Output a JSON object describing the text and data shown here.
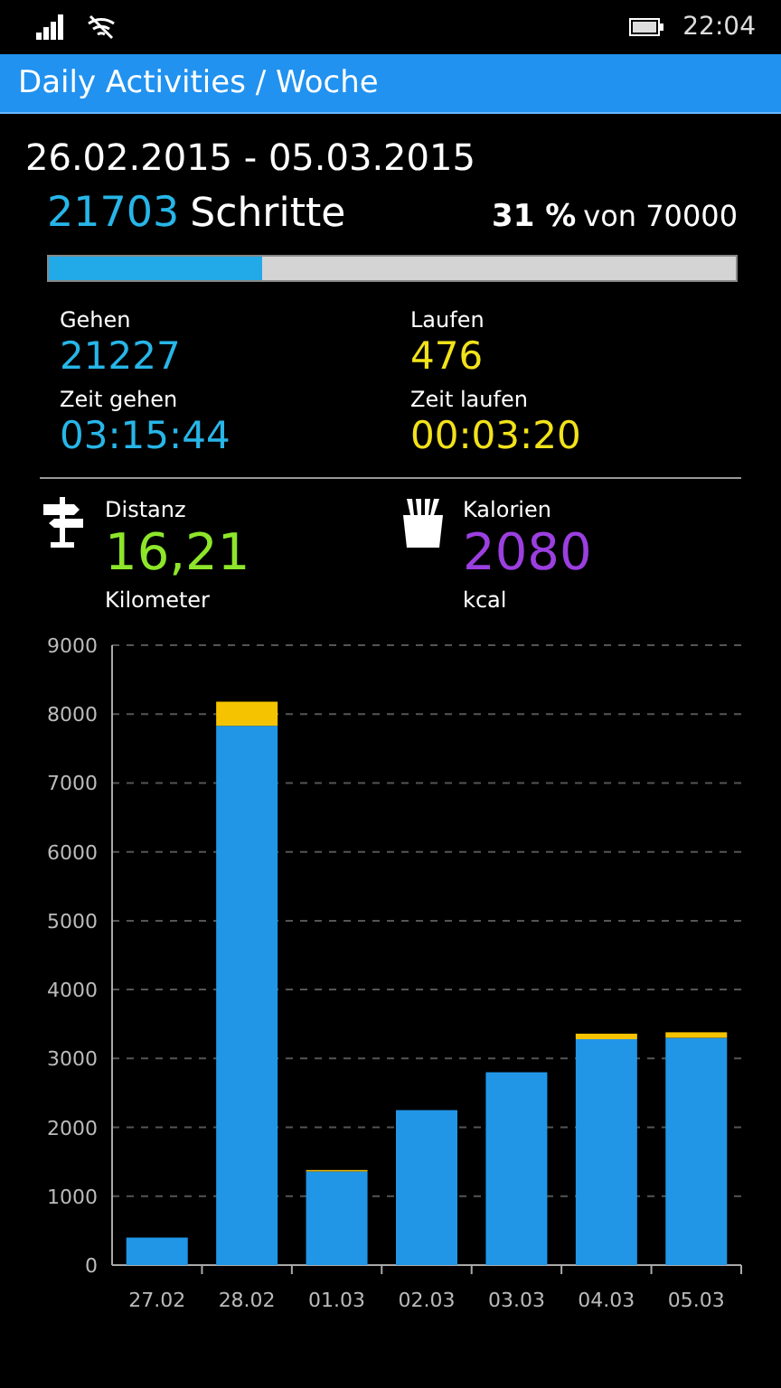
{
  "status_bar": {
    "time": "22:04"
  },
  "header": {
    "title": "Daily Activities / Woche"
  },
  "period": "26.02.2015 - 05.03.2015",
  "steps": {
    "value": "21703",
    "label": "Schritte",
    "percent": "31 %",
    "goal_text": "von 70000",
    "level": 0.31
  },
  "stats": [
    {
      "label": "Gehen",
      "value": "21227",
      "color": "#27b6e8"
    },
    {
      "label": "Laufen",
      "value": "476",
      "color": "#f2e21a"
    },
    {
      "label": "Zeit gehen",
      "value": "03:15:44",
      "color": "#27b6e8"
    },
    {
      "label": "Zeit laufen",
      "value": "00:03:20",
      "color": "#f2e21a"
    }
  ],
  "summary": [
    {
      "kind": "distance",
      "label": "Distanz",
      "value": "16,21",
      "unit": "Kilometer",
      "color": "#8ee62a"
    },
    {
      "kind": "calories",
      "label": "Kalorien",
      "value": "2080",
      "unit": "kcal",
      "color": "#9b3fe0"
    }
  ],
  "chart_data": {
    "type": "bar",
    "stacked": true,
    "categories": [
      "27.02",
      "28.02",
      "01.03",
      "02.03",
      "03.03",
      "04.03",
      "05.03"
    ],
    "grid": true,
    "series": [
      {
        "color": "#2196e6",
        "values": [
          400,
          7830,
          1360,
          2250,
          2800,
          3280,
          3300
        ]
      },
      {
        "color": "#f6c300",
        "values": [
          0,
          350,
          20,
          0,
          0,
          80,
          80
        ]
      }
    ],
    "ylim": [
      0,
      9000
    ],
    "yticks": [
      0,
      1000,
      2000,
      3000,
      4000,
      5000,
      6000,
      7000,
      8000,
      9000
    ]
  }
}
